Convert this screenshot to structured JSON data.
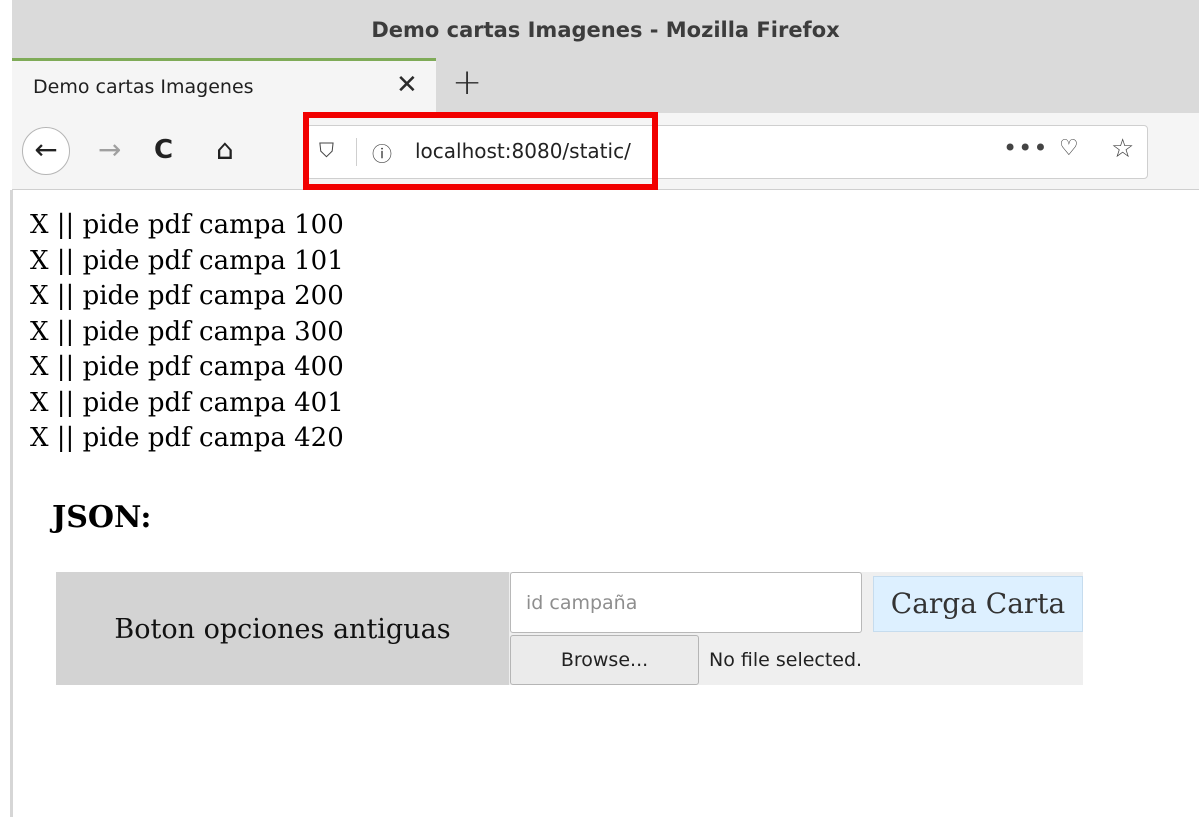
{
  "window": {
    "title": "Demo cartas Imagenes - Mozilla Firefox"
  },
  "tab": {
    "label": "Demo cartas Imagenes",
    "close_glyph": "✕",
    "new_tab_glyph": "+"
  },
  "toolbar": {
    "back_glyph": "←",
    "forward_glyph": "→",
    "reload_glyph": "C",
    "home_glyph": "⌂",
    "url": "localhost:8080/static/",
    "shield_glyph": "⛉",
    "info_glyph": "ⓘ",
    "menu_glyph": "•••",
    "pocket_glyph": "♡",
    "bookmark_glyph": "☆"
  },
  "highlight_color": "#f10000",
  "tab_accent_color": "#7fab58",
  "items": [
    {
      "x": "X",
      "sep": " || ",
      "label": "pide pdf campa 100"
    },
    {
      "x": "X",
      "sep": " || ",
      "label": "pide pdf campa 101"
    },
    {
      "x": "X",
      "sep": " || ",
      "label": "pide pdf campa 200"
    },
    {
      "x": "X",
      "sep": " || ",
      "label": "pide pdf campa 300"
    },
    {
      "x": "X",
      "sep": " || ",
      "label": "pide pdf campa 400"
    },
    {
      "x": "X",
      "sep": " || ",
      "label": "pide pdf campa 401"
    },
    {
      "x": "X",
      "sep": " || ",
      "label": "pide pdf campa 420"
    }
  ],
  "json_heading": "JSON:",
  "form": {
    "old_options_label": "Boton opciones antiguas",
    "id_placeholder": "id campaña",
    "id_value": "",
    "load_label": "Carga Carta",
    "browse_label": "Browse...",
    "file_status": "No file selected."
  }
}
